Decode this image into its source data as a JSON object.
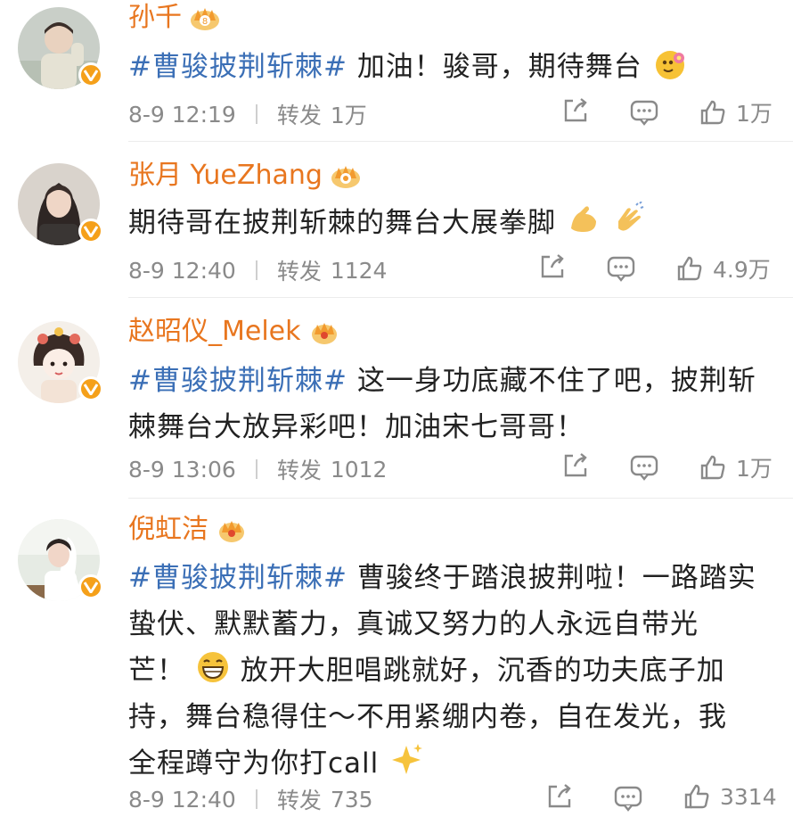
{
  "comments": [
    {
      "name": "孙千",
      "hashtag": "#曹骏披荆斩棘#",
      "text": "加油！骏哥，期待舞台",
      "time": "8-9 12:19",
      "repost_label": "转发",
      "repost_count": "1万",
      "likes": "1万"
    },
    {
      "name": "张月 YueZhang",
      "hashtag": "",
      "text": "期待哥在披荆斩棘的舞台大展拳脚",
      "time": "8-9 12:40",
      "repost_label": "转发",
      "repost_count": "1124",
      "likes": "4.9万"
    },
    {
      "name": "赵昭仪_Melek",
      "hashtag": "#曹骏披荆斩棘#",
      "text_line1": "这一身功底藏不住了吧，披荆斩",
      "text_line2": "棘舞台大放异彩吧！加油宋七哥哥！",
      "time": "8-9 13:06",
      "repost_label": "转发",
      "repost_count": "1012",
      "likes": "1万"
    },
    {
      "name": "倪虹洁",
      "hashtag": "#曹骏披荆斩棘#",
      "text_line1": "曹骏终于踏浪披荆啦！一路踏实",
      "text_line2": "蛰伏、默默蓄力，真诚又努力的人永远自带光",
      "text_line3a": "芒！",
      "text_line3b": "放开大胆唱跳就好，沉香的功夫底子加",
      "text_line4": "持，舞台稳得住～不用紧绷内卷，自在发光，我",
      "text_line5": "全程蹲守为你打call",
      "time": "8-9 12:40",
      "repost_label": "转发",
      "repost_count": "735",
      "likes": "3314"
    }
  ],
  "colors": {
    "name": "#e8761f",
    "hashtag": "#3b6fb6",
    "meta": "#8a8a8a",
    "vip_badge": "#f5a01a"
  },
  "icons": {
    "share": "share-icon",
    "comment": "comment-icon",
    "like": "thumbs-up-icon",
    "badge": "verified-v-icon",
    "crown": "crown-icon"
  }
}
